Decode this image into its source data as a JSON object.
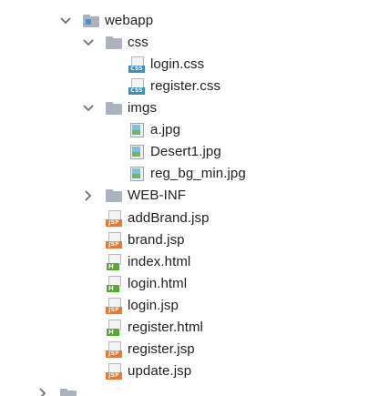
{
  "tree": {
    "items": [
      {
        "label": "webapp",
        "kind": "folder-web",
        "expanded": true
      },
      {
        "label": "css",
        "kind": "folder",
        "expanded": true
      },
      {
        "label": "login.css",
        "kind": "css",
        "badge": "CSS"
      },
      {
        "label": "register.css",
        "kind": "css",
        "badge": "CSS"
      },
      {
        "label": "imgs",
        "kind": "folder",
        "expanded": true
      },
      {
        "label": "a.jpg",
        "kind": "image"
      },
      {
        "label": "Desert1.jpg",
        "kind": "image"
      },
      {
        "label": "reg_bg_min.jpg",
        "kind": "image"
      },
      {
        "label": "WEB-INF",
        "kind": "folder",
        "expanded": false
      },
      {
        "label": "addBrand.jsp",
        "kind": "jsp",
        "badge": "JSP"
      },
      {
        "label": "brand.jsp",
        "kind": "jsp",
        "badge": "JSP"
      },
      {
        "label": "index.html",
        "kind": "html",
        "badge": "H"
      },
      {
        "label": "login.html",
        "kind": "html",
        "badge": "H"
      },
      {
        "label": "login.jsp",
        "kind": "jsp",
        "badge": "JSP"
      },
      {
        "label": "register.html",
        "kind": "html",
        "badge": "H"
      },
      {
        "label": "register.jsp",
        "kind": "jsp",
        "badge": "JSP"
      },
      {
        "label": "update.jsp",
        "kind": "jsp",
        "badge": "JSP"
      }
    ]
  },
  "colors": {
    "folder": "#aab3bd",
    "web_dot": "#4a8fd4",
    "css_badge": "#3a8fbd",
    "jsp_badge": "#e47b3b",
    "html_badge": "#58a838",
    "chevron": "#6e6e6e"
  }
}
